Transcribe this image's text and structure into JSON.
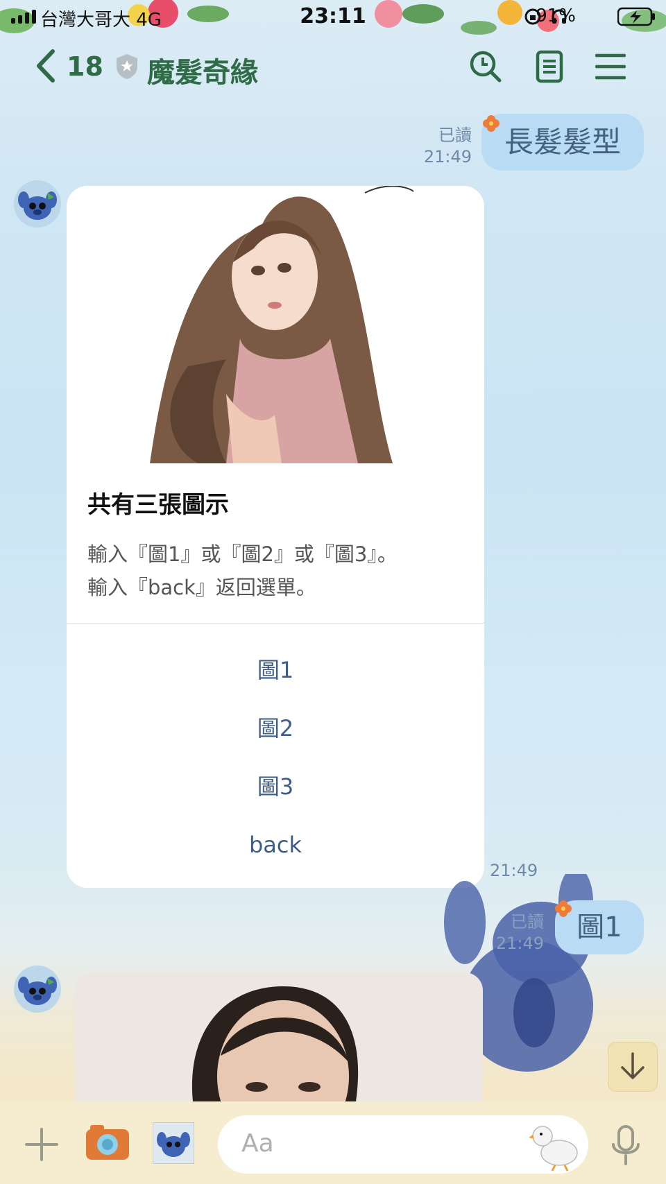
{
  "status_bar": {
    "carrier": "台灣大哥大 4G",
    "time": "23:11",
    "battery": "91%"
  },
  "header": {
    "back_count": "18",
    "chat_title": "魔髮奇緣"
  },
  "messages": {
    "outgoing_1": {
      "text": "長髮髮型",
      "read": "已讀",
      "time": "21:49"
    },
    "card": {
      "title": "共有三張圖示",
      "line1": "輸入『圖1』或『圖2』或『圖3』。",
      "line2": "輸入『back』返回選單。",
      "options": [
        "圖1",
        "圖2",
        "圖3",
        "back"
      ],
      "time": "21:49"
    },
    "outgoing_2": {
      "text": "圖1",
      "read": "已讀",
      "time": "21:49"
    }
  },
  "input_bar": {
    "placeholder": "Aa"
  },
  "colors": {
    "header_green": "#2e6b46",
    "bubble_blue": "#b9dbf3",
    "link_blue": "#3d5d86"
  }
}
